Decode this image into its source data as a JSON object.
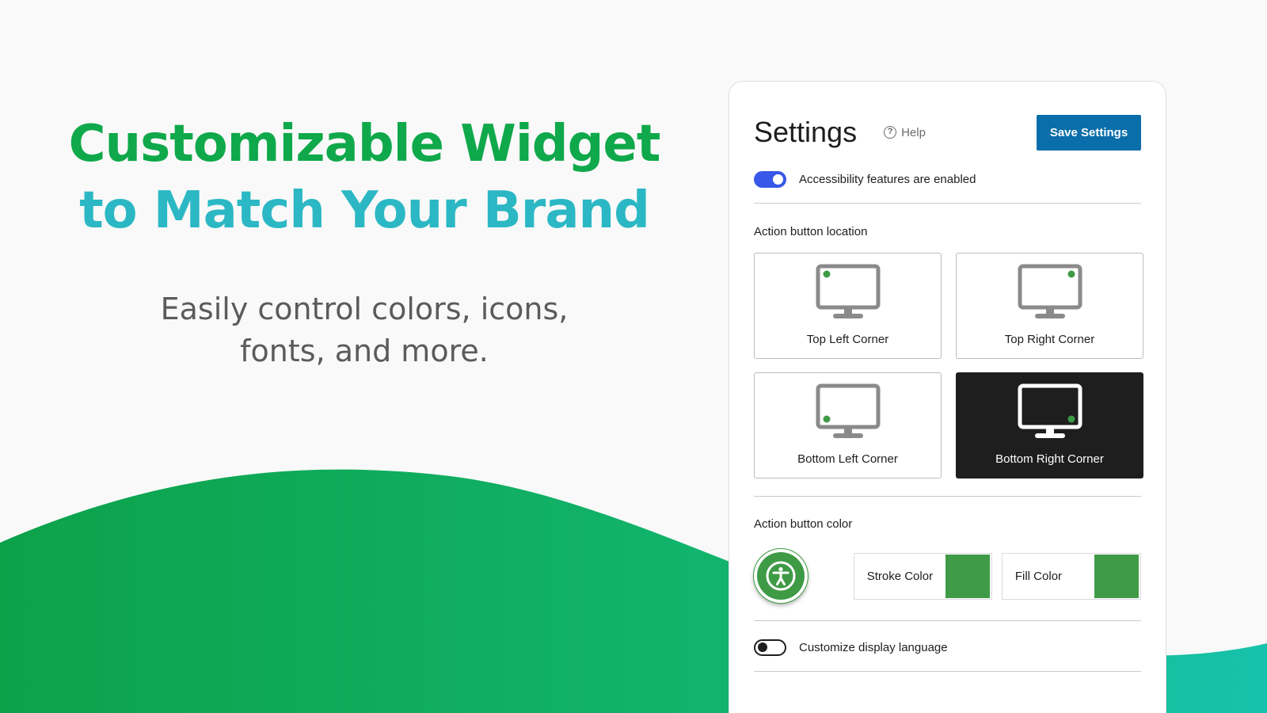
{
  "hero": {
    "headline_line1": "Customizable Widget",
    "headline_line2": "to Match Your Brand",
    "subtext": "Easily control colors, icons, fonts, and more."
  },
  "colors": {
    "headline_green": "#0fa84a",
    "headline_teal": "#2bb8c4",
    "wave_gradient": [
      "#0ca24a",
      "#17c2ad"
    ],
    "save_button": "#0a6eaa",
    "toggle_on": "#3858e9",
    "action_button": "#3f9a45",
    "stroke_color": "#409b48",
    "fill_color": "#409b48"
  },
  "settings": {
    "title": "Settings",
    "help_label": "Help",
    "save_label": "Save Settings",
    "accessibility_toggle": {
      "label": "Accessibility features are enabled",
      "on": true
    },
    "location_section_label": "Action button location",
    "locations": [
      {
        "label": "Top Left Corner",
        "selected": false,
        "icon": "monitor-top-left-icon"
      },
      {
        "label": "Top Right Corner",
        "selected": false,
        "icon": "monitor-top-right-icon"
      },
      {
        "label": "Bottom Left Corner",
        "selected": false,
        "icon": "monitor-bottom-left-icon"
      },
      {
        "label": "Bottom Right Corner",
        "selected": true,
        "icon": "monitor-bottom-right-icon"
      }
    ],
    "color_section_label": "Action button color",
    "stroke_color_label": "Stroke Color",
    "fill_color_label": "Fill Color",
    "language_toggle": {
      "label": "Customize display language",
      "on": false
    }
  }
}
